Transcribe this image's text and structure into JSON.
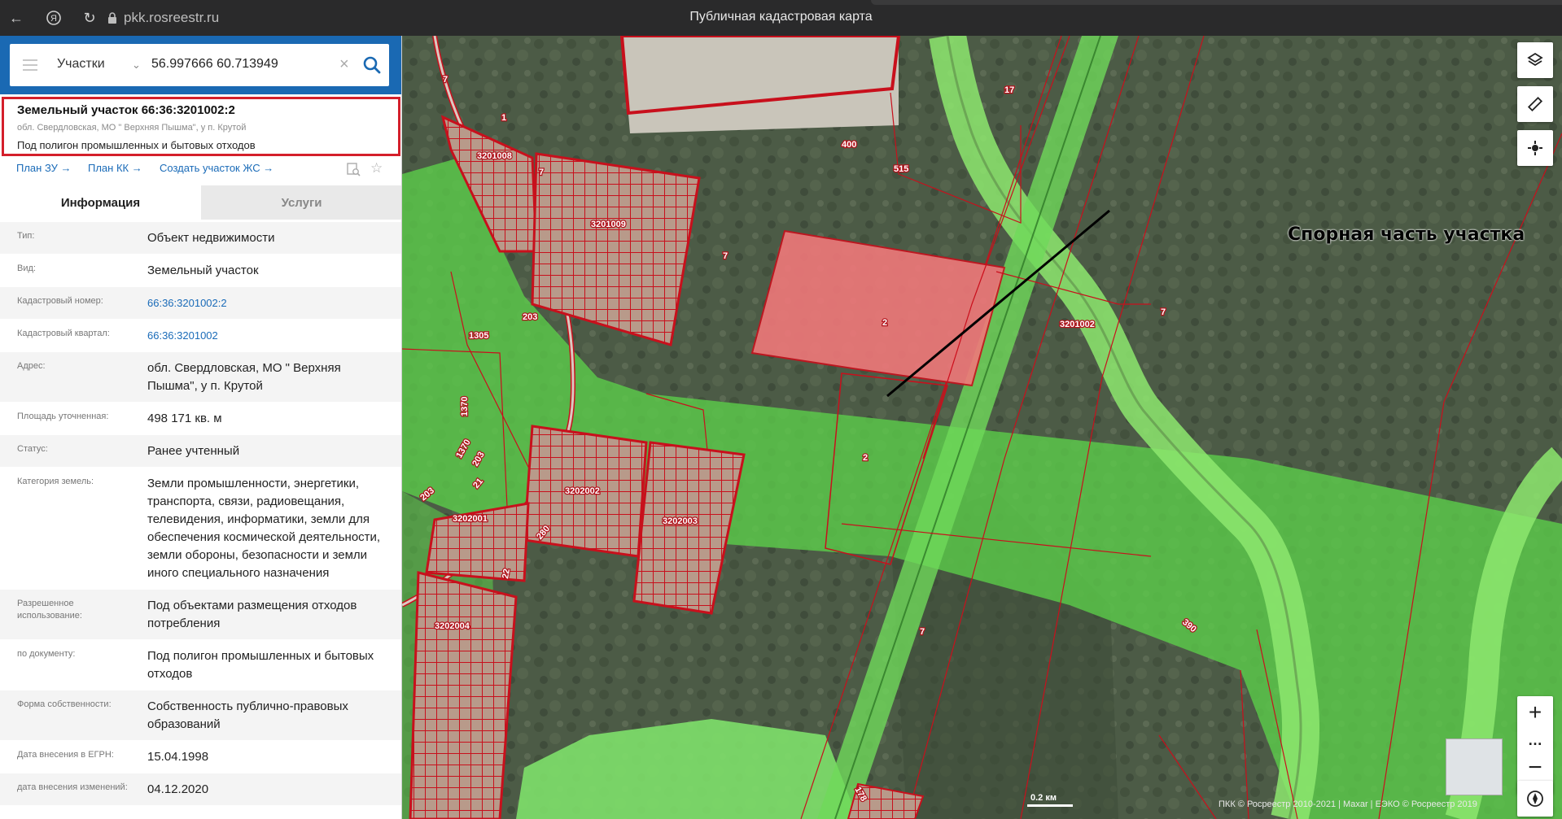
{
  "browser": {
    "url": "pkk.rosreestr.ru",
    "page_title": "Публичная кадастровая карта"
  },
  "search": {
    "type": "Участки",
    "value": "56.997666 60.713949"
  },
  "parcel": {
    "title": "Земельный участок 66:36:3201002:2",
    "address": "обл. Свердловская, МО \" Верхняя Пышма\", у п. Крутой",
    "purpose": "Под полигон промышленных и бытовых отходов"
  },
  "links": {
    "plan_zu": "План ЗУ",
    "plan_kk": "План КК",
    "create_zhs": "Создать участок ЖС"
  },
  "tabs": {
    "info": "Информация",
    "services": "Услуги"
  },
  "info": [
    {
      "key": "Тип:",
      "value": "Объект недвижимости"
    },
    {
      "key": "Вид:",
      "value": "Земельный участок"
    },
    {
      "key": "Кадастровый номер:",
      "value": "66:36:3201002:2",
      "link": true
    },
    {
      "key": "Кадастровый квартал:",
      "value": "66:36:3201002",
      "link": true
    },
    {
      "key": "Адрес:",
      "value": "обл. Свердловская, МО \" Верхняя Пышма\", у п. Крутой"
    },
    {
      "key": "Площадь уточненная:",
      "value": "498 171 кв. м"
    },
    {
      "key": "Статус:",
      "value": "Ранее учтенный"
    },
    {
      "key": "Категория земель:",
      "value": "Земли промышленности, энергетики, транспорта, связи, радиовещания, телевидения, информатики, земли для обеспечения космической деятельности, земли обороны, безопасности и земли иного специального назначения"
    },
    {
      "key": "Разрешенное использование:",
      "value": "Под объектами размещения отходов потребления"
    },
    {
      "key": "по документу:",
      "value": "Под полигон промышленных и бытовых отходов"
    },
    {
      "key": "Форма собственности:",
      "value": "Собственность публично-правовых образований"
    },
    {
      "key": "Дата внесения в ЕГРН:",
      "value": "15.04.1998"
    },
    {
      "key": "дата внесения изменений:",
      "value": "04.12.2020"
    }
  ],
  "map": {
    "annotation": "Спорная часть участка",
    "scale": "0.2 км",
    "copyright": "ПКК © Росреестр 2010-2021 | Maxar | ЕЭКО © Росреестр 2019",
    "labels": [
      "7",
      "1",
      "3201008",
      "7",
      "3201009",
      "400",
      "515",
      "17",
      "7",
      "203",
      "1305",
      "2",
      "3201002",
      "7",
      "1370",
      "1370",
      "203",
      "203",
      "21",
      "3202002",
      "3202003",
      "3202001",
      "280",
      "22",
      "2",
      "3202004",
      "7",
      "178",
      "390"
    ]
  },
  "colors": {
    "header_blue": "#1a69b3",
    "highlight_red": "#d41f2b",
    "link_blue": "#1a6bb8",
    "zone_green": "#5ccf4a",
    "parcel_pink": "#f0787a"
  }
}
